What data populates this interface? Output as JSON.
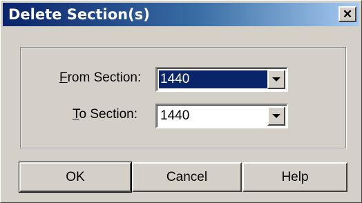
{
  "window": {
    "title": "Delete Section(s)",
    "close_glyph": "✕"
  },
  "form": {
    "from_label_accel": "F",
    "from_label_rest": "rom Section:",
    "from_value": "1440",
    "to_label_accel": "T",
    "to_label_rest": "o Section:",
    "to_value": "1440"
  },
  "buttons": {
    "ok": "OK",
    "cancel": "Cancel",
    "help": "Help"
  },
  "colors": {
    "titlebar_start": "#0a246a",
    "titlebar_end": "#a6caf0",
    "dialog_face": "#d4d0c8",
    "selection": "#0a246a"
  }
}
